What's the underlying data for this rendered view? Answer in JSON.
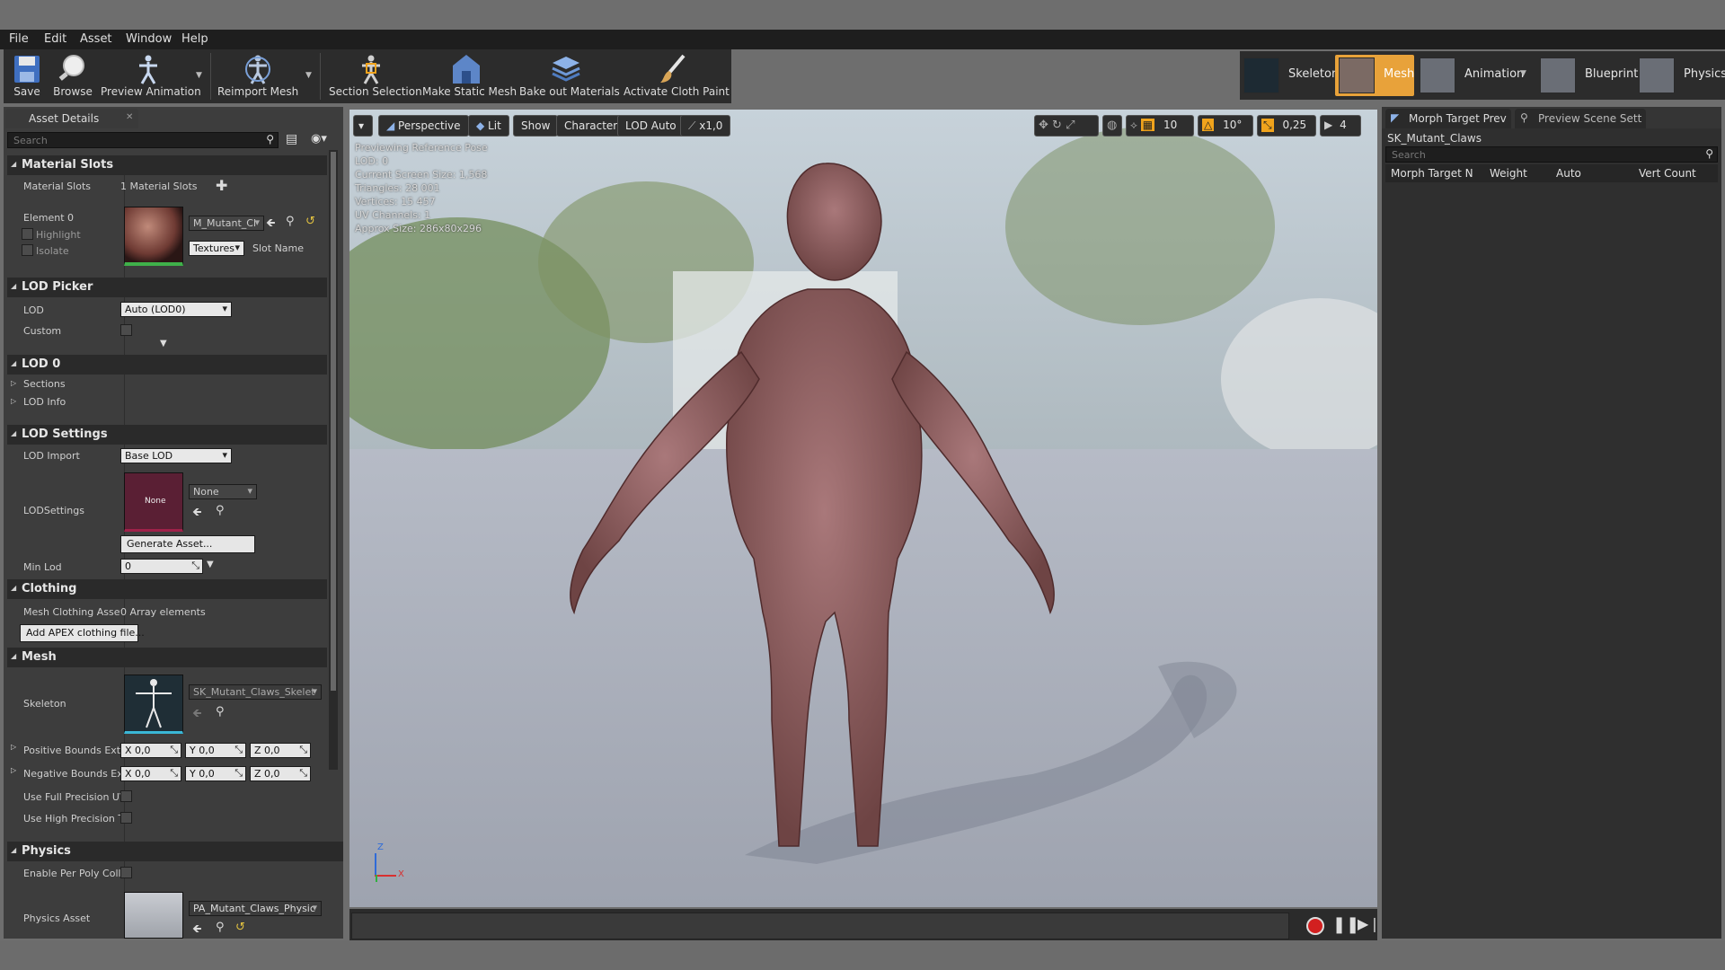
{
  "menu": {
    "file": "File",
    "edit": "Edit",
    "asset": "Asset",
    "window": "Window",
    "help": "Help"
  },
  "toolbar": {
    "save": "Save",
    "browse": "Browse",
    "preview_animation": "Preview Animation",
    "reimport_mesh": "Reimport Mesh",
    "section_selection": "Section Selection",
    "make_static_mesh": "Make Static Mesh",
    "bake_out_materials": "Bake out Materials",
    "activate_cloth_paint": "Activate Cloth Paint"
  },
  "modes": {
    "skeleton": "Skeleton",
    "mesh": "Mesh",
    "animation": "Animation",
    "blueprint": "Blueprint",
    "physics": "Physics"
  },
  "asset_details": {
    "tab_label": "Asset Details",
    "search_placeholder": "Search",
    "material_slots": {
      "title": "Material Slots",
      "label": "Material Slots",
      "count_text": "1 Material Slots",
      "element_label": "Element 0",
      "highlight": "Highlight",
      "isolate": "Isolate",
      "material_name": "M_Mutant_Cl",
      "textures": "Textures",
      "slot_name": "Slot Name"
    },
    "lod_picker": {
      "title": "LOD Picker",
      "lod_label": "LOD",
      "lod_value": "Auto (LOD0)",
      "custom_label": "Custom"
    },
    "lod0": {
      "title": "LOD 0",
      "sections": "Sections",
      "lod_info": "LOD Info"
    },
    "lod_settings": {
      "title": "LOD Settings",
      "lod_import_label": "LOD Import",
      "lod_import_value": "Base LOD",
      "lodsettings_label": "LODSettings",
      "thumb_text": "None",
      "none_value": "None",
      "generate_asset": "Generate Asset...",
      "min_lod_label": "Min Lod",
      "min_lod_value": "0"
    },
    "clothing": {
      "title": "Clothing",
      "mesh_clothing_label": "Mesh Clothing Asset",
      "array_text": "0 Array elements",
      "add_apex": "Add APEX clothing file..."
    },
    "mesh": {
      "title": "Mesh",
      "skeleton_label": "Skeleton",
      "skeleton_value": "SK_Mutant_Claws_Skelet",
      "pos_bounds_label": "Positive Bounds Exte",
      "neg_bounds_label": "Negative Bounds Ext",
      "pos_x": "X 0,0",
      "pos_y": "Y 0,0",
      "pos_z": "Z 0,0",
      "neg_x": "X 0,0",
      "neg_y": "Y 0,0",
      "neg_z": "Z 0,0",
      "full_precision_label": "Use Full Precision UV",
      "high_precision_label": "Use High Precision Ta"
    },
    "physics": {
      "title": "Physics",
      "per_poly_label": "Enable Per Poly Collis",
      "physics_asset_label": "Physics Asset",
      "physics_asset_value": "PA_Mutant_Claws_Physic"
    }
  },
  "viewport": {
    "perspective": "Perspective",
    "lit": "Lit",
    "show": "Show",
    "character": "Character",
    "lod_auto": "LOD Auto",
    "speed": "x1,0",
    "grid_snap": "10",
    "rot_snap": "10°",
    "scale_snap": "0,25",
    "cam_speed": "4",
    "info": [
      "Previewing Reference Pose",
      "LOD: 0",
      "Current Screen Size: 1,568",
      "Triangles: 28 001",
      "Vertices: 15 457",
      "UV Channels: 1",
      "Approx Size: 286x80x296"
    ],
    "axis_z": "Z",
    "axis_x": "X"
  },
  "right_panel": {
    "tab_morph": "Morph Target Prev",
    "tab_scene": "Preview Scene Sett",
    "asset_name": "SK_Mutant_Claws",
    "search_placeholder": "Search",
    "columns": [
      "Morph Target N",
      "Weight",
      "Auto",
      "Vert Count"
    ]
  },
  "colors": {
    "mesh_mode_active": "#e8a23a",
    "accent_orange": "#f0a31c",
    "record_red": "#d22020"
  },
  "icons": [
    "save-icon",
    "browse-icon",
    "preview-animation-icon",
    "reimport-mesh-icon",
    "section-selection-icon",
    "make-static-mesh-icon",
    "bake-materials-icon",
    "cloth-paint-icon"
  ]
}
